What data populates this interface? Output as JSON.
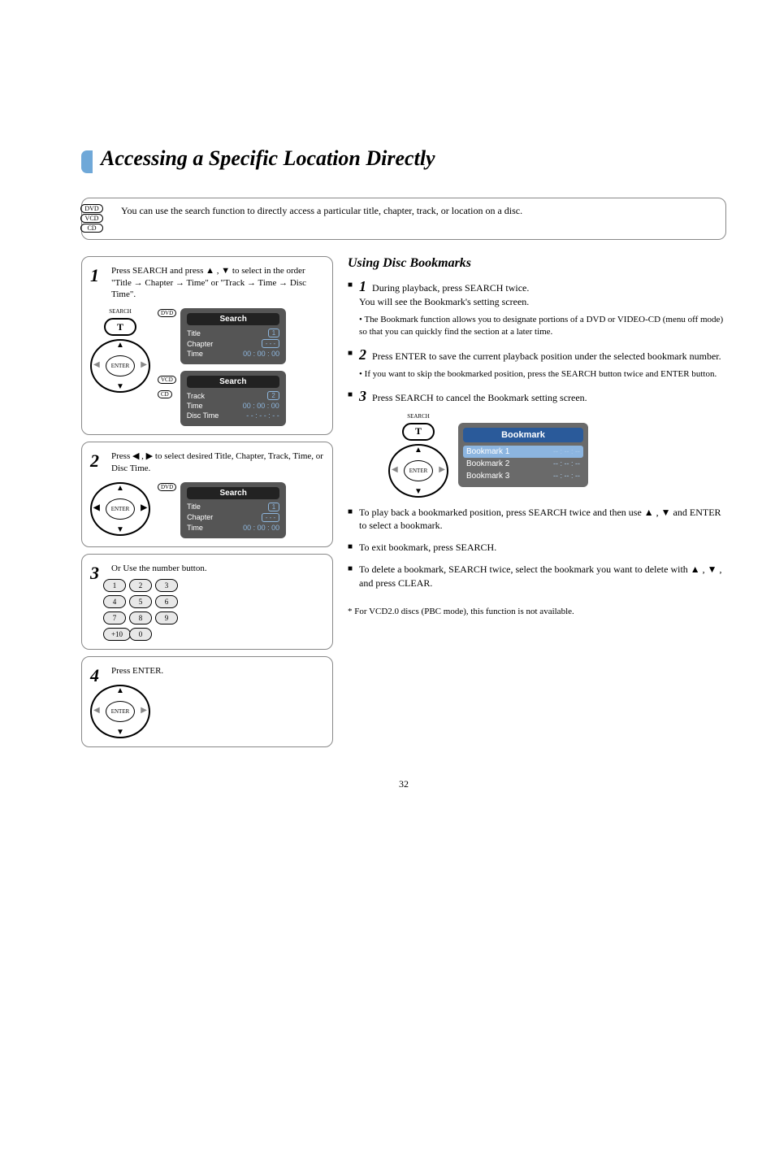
{
  "page_title": "Accessing a Specific Location Directly",
  "disc_labels": [
    "DVD",
    "VCD",
    "CD"
  ],
  "banner_text": "You can use the search function to directly access a particular title, chapter, track, or location on a disc.",
  "step1": {
    "num": "1",
    "text": "Press SEARCH and press ▲ , ▼ to select in the order \"Title → Chapter → Time\" or \"Track → Time → Disc Time\"."
  },
  "step2": {
    "num": "2",
    "text": "Press ◀ , ▶ to select desired Title, Chapter, Track, Time, or Disc Time."
  },
  "step3": {
    "num": "3",
    "text": "Or Use the number button."
  },
  "step4": {
    "num": "4",
    "text": "Press ENTER."
  },
  "search_btn_label": "SEARCH",
  "search_btn_text": "T",
  "enter_label": "ENTER",
  "osd": {
    "header": "Search",
    "title": "Title",
    "chapter": "Chapter",
    "time": "Time",
    "track": "Track",
    "disc_time": "Disc Time",
    "val_1": "1",
    "val_2": "2",
    "val_dashes": "- - -",
    "val_time_zero": "00 : 00 : 00",
    "val_time_dashes": "- - : - - : - -"
  },
  "numpad": [
    "1",
    "2",
    "3",
    "4",
    "5",
    "6",
    "7",
    "8",
    "9",
    "+10",
    "0"
  ],
  "right": {
    "section_title": "Using Disc Bookmarks",
    "step1": {
      "num": "1",
      "text_a": "During playback, press SEARCH twice.",
      "text_b": "You will see the Bookmark's setting screen.",
      "bullet": "The Bookmark function allows you to designate portions of a DVD or VIDEO-CD (menu off mode) so that you can quickly find the section at a later time."
    },
    "step2": {
      "num": "2",
      "text": "Press ENTER to save the current playback position under the selected bookmark number.",
      "bullet": "If you want to skip the bookmarked position, press the SEARCH button twice and ENTER button."
    },
    "step3": {
      "num": "3",
      "text": "Press SEARCH to cancel the Bookmark setting screen.",
      "b1": "To play back a bookmarked position, press SEARCH twice and then use ▲ , ▼ and ENTER to select a bookmark.",
      "b2": "To exit bookmark, press SEARCH.",
      "b3": "To delete a bookmark, SEARCH twice, select the bookmark you want to delete with ▲ , ▼ , and press CLEAR."
    }
  },
  "bookmark": {
    "header": "Bookmark",
    "row1": "Bookmark 1",
    "row2": "Bookmark 2",
    "row3": "Bookmark 3",
    "dashes": "-- : -- : --"
  },
  "footnote": "* For VCD2.0 discs (PBC mode), this function is not available.",
  "page_number": "32"
}
